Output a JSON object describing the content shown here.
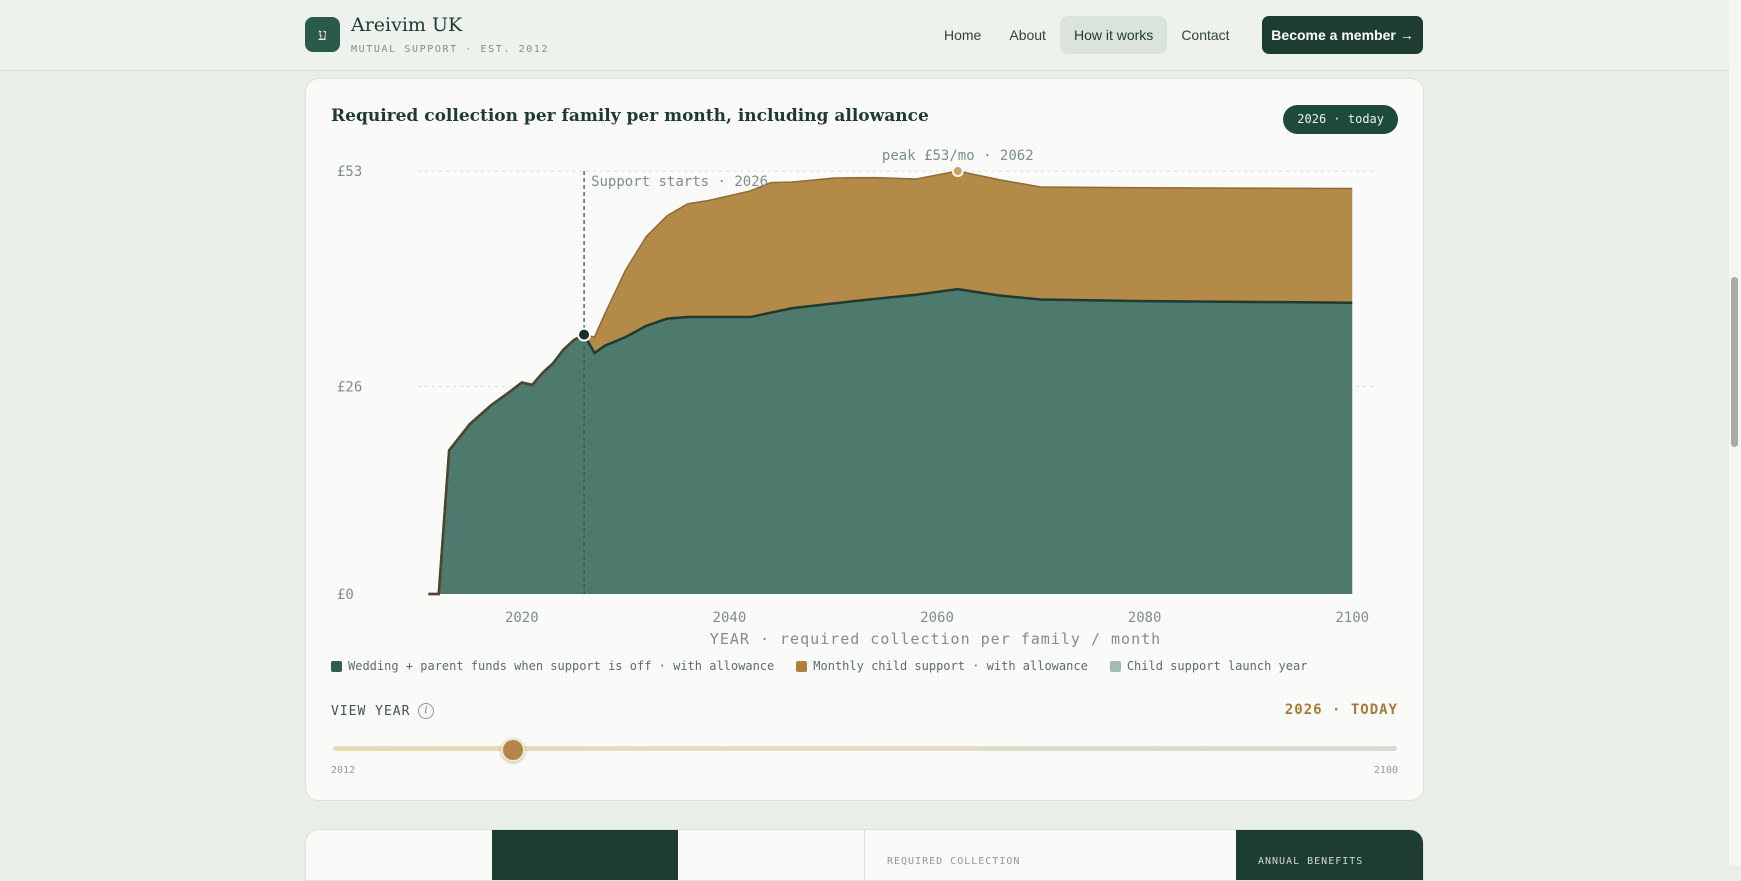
{
  "header": {
    "logo_glyph": "ע",
    "brand_name": "Areivim UK",
    "brand_tagline": "MUTUAL SUPPORT · EST. 2012",
    "nav": [
      {
        "label": "Home"
      },
      {
        "label": "About"
      },
      {
        "label": "How it works",
        "active": true
      },
      {
        "label": "Contact"
      }
    ],
    "cta_label": "Become a member →"
  },
  "card": {
    "title": "Required collection per family per month, including allowance",
    "year_pill": "2026 · today",
    "view_year_label": "VIEW YEAR",
    "info_icon": "i",
    "view_year_value": "2026 · TODAY",
    "slider": {
      "min_label": "2012",
      "max_label": "2100",
      "min": 2012,
      "max": 2100,
      "value": 2026
    }
  },
  "chart_data": {
    "type": "area",
    "xlabel": "YEAR · required collection per family / month",
    "ylabel": "",
    "x_ticks": [
      "2020",
      "2040",
      "2060",
      "2080",
      "2100"
    ],
    "y_ticks": [
      "£0",
      "£26",
      "£53"
    ],
    "xlim": [
      2010,
      2102
    ],
    "ylim": [
      0,
      53
    ],
    "grid": true,
    "stacked": true,
    "annotations": {
      "support_start": {
        "label": "Support starts · 2026",
        "x": 2026
      },
      "peak": {
        "label": "peak £53/mo · 2062",
        "x": 2062,
        "y": 53
      }
    },
    "series": [
      {
        "name": "Wedding + parent funds when support is off · with allowance",
        "color": "#4e7a6e",
        "x": [
          2011,
          2012,
          2013,
          2015,
          2017,
          2019,
          2020,
          2021,
          2022,
          2023,
          2024,
          2025,
          2026,
          2027,
          2028,
          2030,
          2032,
          2034,
          2036,
          2042,
          2046,
          2052,
          2058,
          2062,
          2066,
          2070,
          2080,
          2100
        ],
        "values": [
          0,
          0,
          18,
          21.3,
          23.6,
          25.5,
          26.5,
          26.2,
          27.7,
          28.9,
          30.6,
          31.8,
          32.5,
          30.2,
          31.1,
          32.2,
          33.6,
          34.5,
          34.7,
          34.7,
          35.8,
          36.7,
          37.5,
          38.2,
          37.4,
          36.9,
          36.7,
          36.5
        ]
      },
      {
        "name": "Monthly child support · with allowance",
        "color": "#b38a48",
        "x": [
          2026,
          2028,
          2030,
          2032,
          2034,
          2036,
          2038,
          2042,
          2044,
          2046,
          2050,
          2054,
          2058,
          2062,
          2066,
          2070,
          2080,
          2100
        ],
        "values": [
          0,
          4,
          8.4,
          11.2,
          12.9,
          14.2,
          14.6,
          15.8,
          16.3,
          15.8,
          15.7,
          15.2,
          14.5,
          14.8,
          14.5,
          14.1,
          14.2,
          14.3
        ]
      }
    ],
    "legend": [
      {
        "name": "Wedding + parent funds when support is off · with allowance",
        "color": "#2f5e50"
      },
      {
        "name": "Monthly child support · with allowance",
        "color": "#b07f3c"
      },
      {
        "name": "Child support launch year",
        "color": "#a3bbb1"
      }
    ]
  },
  "bottom": {
    "stat_label_1": "REQUIRED COLLECTION",
    "stat_label_2": "ANNUAL BENEFITS"
  },
  "colors": {
    "accent_dark": "#1d3d33",
    "gold": "#b38a48",
    "teal": "#4e7a6e"
  }
}
